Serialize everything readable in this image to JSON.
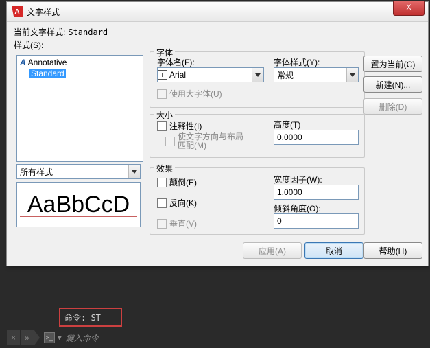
{
  "titlebar": {
    "icon_letter": "A",
    "title": "文字样式",
    "close": "X"
  },
  "current_label": "当前文字样式:",
  "current_value": "Standard",
  "styles_label": "样式(S):",
  "styles_items": {
    "annotative": "Annotative",
    "standard": "Standard"
  },
  "all_styles_label": "所有样式",
  "preview_text": "AaBbCcD",
  "font_group": "字体",
  "font_name_label": "字体名(F):",
  "font_name_value": "Arial",
  "font_style_label": "字体样式(Y):",
  "font_style_value": "常规",
  "bigfont_label": "使用大字体(U)",
  "size_group": "大小",
  "annot_label": "注释性(I)",
  "paper_match_label": "使文字方向与布局\n匹配(M)",
  "height_label": "高度(T)",
  "height_value": "0.0000",
  "effects_group": "效果",
  "upside_label": "颠倒(E)",
  "backward_label": "反向(K)",
  "vertical_label": "垂直(V)",
  "width_label": "宽度因子(W):",
  "width_value": "1.0000",
  "oblique_label": "倾斜角度(O):",
  "oblique_value": "0",
  "btn_setcur": "置为当前(C)",
  "btn_new": "新建(N)...",
  "btn_delete": "删除(D)",
  "btn_apply": "应用(A)",
  "btn_cancel": "取消",
  "btn_help": "帮助(H)",
  "command_text": "命令: ST",
  "cmdbar": {
    "x": "×",
    "chev": "»",
    "icon": ">_",
    "hint": "鍵入命令"
  }
}
